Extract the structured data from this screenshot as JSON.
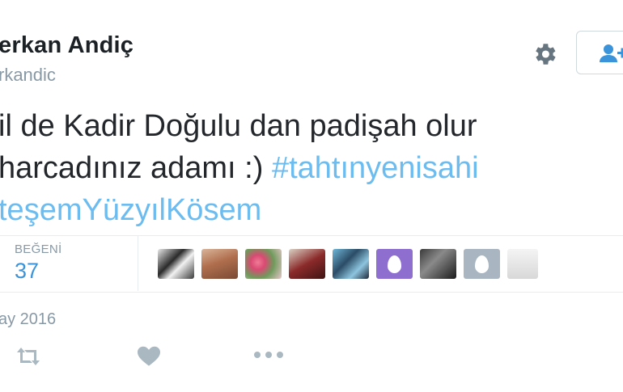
{
  "user": {
    "name": "erkan Andiç",
    "handle": "rkandic"
  },
  "tweet": {
    "line1": "il de Kadir Doğulu dan padişah olur",
    "line2_text": "harcadınız adamı :) ",
    "line2_hashtag": "#tahtınyenisahi",
    "line3_hashtag": "teşemYüzyılKösem"
  },
  "stats": {
    "likes_label": "BEĞENİ",
    "likes_count": "37"
  },
  "liked_by": [
    {
      "icon": "avatar-photo"
    },
    {
      "icon": "avatar-photo"
    },
    {
      "icon": "avatar-photo"
    },
    {
      "icon": "avatar-photo"
    },
    {
      "icon": "avatar-photo"
    },
    {
      "icon": "egg-avatar",
      "color": "#8e6fd0"
    },
    {
      "icon": "avatar-photo"
    },
    {
      "icon": "egg-avatar",
      "color": "#a9b6c1"
    },
    {
      "icon": "avatar-photo"
    }
  ],
  "timestamp": "ay 2016",
  "actions": [
    "retweet-icon",
    "like-icon",
    "more-icon"
  ],
  "colors": {
    "hashtag": "#6cbcf0",
    "likes": "#3b94d9",
    "meta": "#8899a6",
    "follow": "#3b94d9"
  }
}
